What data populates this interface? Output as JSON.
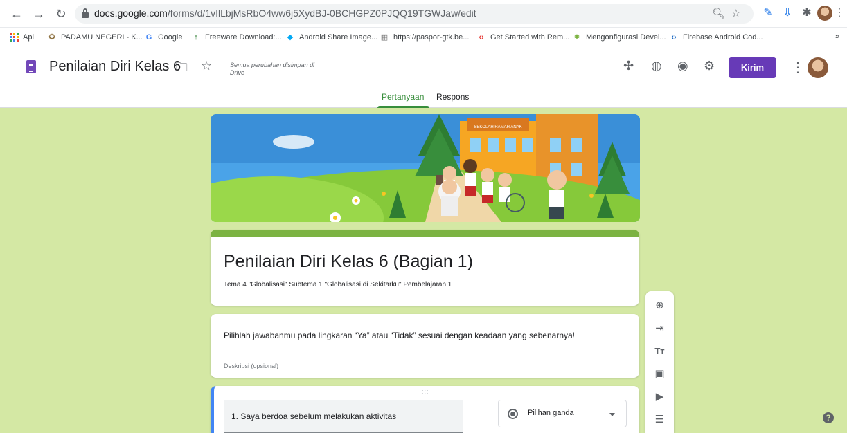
{
  "browser": {
    "url_host": "docs.google.com",
    "url_path": "/forms/d/1vIlLbjMsRbO4ww6j5XydBJ-0BCHGPZ0PJQQ19TGWJaw/edit",
    "bookmarks": [
      {
        "label": "Apl",
        "icon": "apps-grid-icon"
      },
      {
        "label": "PADAMU NEGERI - K...",
        "icon": "garuda-icon"
      },
      {
        "label": "Google",
        "icon": "google-g-icon"
      },
      {
        "label": "Freeware Download:...",
        "icon": "freeware-icon"
      },
      {
        "label": "Android Share Image...",
        "icon": "android-share-icon"
      },
      {
        "label": "https://paspor-gtk.be...",
        "icon": "paspor-icon"
      },
      {
        "label": "Get Started with Rem...",
        "icon": "code-icon"
      },
      {
        "label": "Mengonfigurasi Devel...",
        "icon": "android-icon"
      },
      {
        "label": "Firebase Android Cod...",
        "icon": "code-icon"
      }
    ],
    "overflow_label": "»"
  },
  "header": {
    "title": "Penilaian Diri Kelas 6",
    "saved_note": "Semua perubahan disimpan di Drive",
    "send_label": "Kirim",
    "tabs": [
      {
        "label": "Pertanyaan",
        "active": true
      },
      {
        "label": "Respons",
        "active": false
      }
    ]
  },
  "form": {
    "title": "Penilaian Diri Kelas 6 (Bagian 1)",
    "subtitle": "Tema 4 \"Globalisasi\" Subtema 1 \"Globalisasi di Sekitarku\" Pembelajaran 1",
    "section_text": "Pilihlah jawabanmu pada lingkaran “Ya” atau “Tidak” sesuai dengan keadaan yang sebenarnya!",
    "section_hint": "Deskripsi (opsional)",
    "question": "1. Saya berdoa sebelum melakukan aktivitas",
    "question_type": "Pilihan ganda",
    "drag_handle": ":::",
    "banner_sign": "SEKOLAH RAMAH ANAK"
  },
  "colors": {
    "accent": "#673ab7",
    "theme_green": "#7cb342",
    "canvas_bg": "#d4e8a4",
    "tab_active": "#388e3c",
    "question_border": "#4285f4"
  }
}
